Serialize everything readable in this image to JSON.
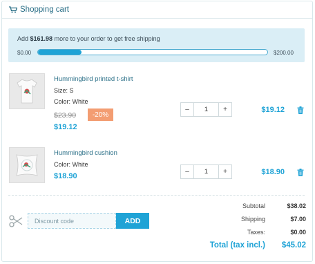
{
  "header": {
    "title": "Shopping cart",
    "icon": "cart-icon"
  },
  "shipping": {
    "message_prefix": "Add",
    "amount_left": "$161.98",
    "message_suffix": "more to your order to get free shipping",
    "min_label": "$0.00",
    "max_label": "$200.00",
    "progress_fraction": 0.19
  },
  "items": [
    {
      "name": "Hummingbird printed t-shirt",
      "attributes": [
        "Size: S",
        "Color: White"
      ],
      "old_price": "$23.90",
      "discount": "-20%",
      "unit_price": "$19.12",
      "quantity": "1",
      "line_total": "$19.12"
    },
    {
      "name": "Hummingbird cushion",
      "attributes": [
        "Color: White"
      ],
      "unit_price": "$18.90",
      "quantity": "1",
      "line_total": "$18.90"
    }
  ],
  "qty_controls": {
    "minus": "–",
    "plus": "+"
  },
  "discount": {
    "placeholder": "Discount code",
    "button_label": "ADD",
    "icon": "scissors-icon"
  },
  "summary": {
    "subtotal_label": "Subtotal",
    "subtotal_value": "$38.02",
    "shipping_label": "Shipping",
    "shipping_value": "$7.00",
    "taxes_label": "Taxes:",
    "taxes_value": "$0.00",
    "total_label": "Total (tax incl.)",
    "total_value": "$45.02"
  },
  "colors": {
    "accent": "#1fa3d6",
    "badge": "#f39d72",
    "info_bg": "#daeef6",
    "title": "#2a6f87"
  }
}
